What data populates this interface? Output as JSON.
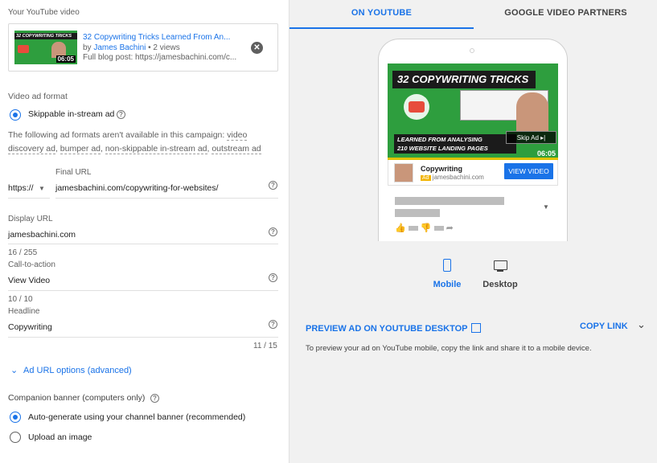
{
  "left": {
    "video_section_label": "Your YouTube video",
    "video": {
      "thumb_title": "32 COPYWRITING TRICKS",
      "thumb_sub": "LEARNED FROM ANALYSING 210 WEBSITE LANDING PAGES",
      "duration": "06:05",
      "title": "32 Copywriting Tricks Learned From An...",
      "by": "by",
      "channel": "James Bachini",
      "views": "• 2 views",
      "description": "Full blog post: https://jamesbachini.com/c..."
    },
    "format_label": "Video ad format",
    "format_option": "Skippable in-stream ad",
    "unavailable_prefix": "The following ad formats aren't available in this campaign:",
    "unavailable_line1": "video",
    "unavailable_line2a": "discovery ad",
    "unavailable_line2b": "bumper ad",
    "unavailable_line2c": "non-skippable in-stream ad",
    "unavailable_line2d": "outstream ad",
    "final_url_label": "Final URL",
    "protocol": "https://",
    "final_url": "jamesbachini.com/copywriting-for-websites/",
    "display_url_label": "Display URL",
    "display_url": "jamesbachini.com",
    "display_count": "16 / 255",
    "cta_label": "Call-to-action",
    "cta": "View Video",
    "cta_count": "10 / 10",
    "headline_label": "Headline",
    "headline": "Copywriting",
    "headline_count": "11 / 15",
    "url_options": "Ad URL options (advanced)",
    "companion_label": "Companion banner (computers only)",
    "companion_auto": "Auto-generate using your channel banner (recommended)",
    "companion_upload": "Upload an image"
  },
  "right": {
    "tab_youtube": "ON YOUTUBE",
    "tab_partners": "GOOGLE VIDEO PARTNERS",
    "preview": {
      "thumb_title": "32 COPYWRITING TRICKS",
      "thumb_sub1": "LEARNED FROM ANALYSING",
      "thumb_sub2": "210 WEBSITE LANDING PAGES",
      "skip_ad": "Skip Ad ▸|",
      "duration": "06:05",
      "ad_headline": "Copywriting",
      "ad_badge": "Ad",
      "ad_domain": "jamesbachini.com",
      "view_video": "VIEW VIDEO"
    },
    "device_mobile": "Mobile",
    "device_desktop": "Desktop",
    "preview_link": "PREVIEW AD ON YOUTUBE DESKTOP",
    "copy_link": "COPY LINK",
    "hint": "To preview your ad on YouTube mobile, copy the link and share it to a mobile device."
  },
  "colors": {
    "accent": "#1a73e8",
    "thumb_green": "#2e9e3e",
    "panel_bg": "#f1f1f1"
  }
}
